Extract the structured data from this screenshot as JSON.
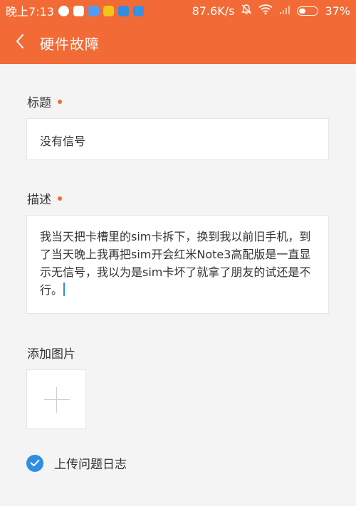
{
  "status_bar": {
    "time": "晚上7:13",
    "network_speed": "87.6K/s",
    "battery_percent": "37%",
    "battery_level": 0.37,
    "icons": [
      "qq-icon",
      "toutiao-icon",
      "cloud-icon",
      "message-icon",
      "app-icon",
      "document-icon",
      "mute-icon",
      "wifi-icon",
      "signal-icon",
      "battery-icon"
    ]
  },
  "header": {
    "title": "硬件故障",
    "back_icon": "chevron-left-icon"
  },
  "form": {
    "title_label": "标题",
    "title_value": "没有信号",
    "description_label": "描述",
    "description_value": "我当天把卡槽里的sim卡拆下，换到我以前旧手机，到了当天晚上我再把sim开会红米Note3高配版是一直显示无信号，我以为是sim卡坏了就拿了朋友的试还是不行。",
    "add_image_label": "添加图片",
    "upload_log_label": "上传问题日志",
    "upload_log_checked": true
  },
  "colors": {
    "accent": "#f26a36",
    "checkbox": "#2f8de4",
    "background": "#f4f4f4"
  }
}
